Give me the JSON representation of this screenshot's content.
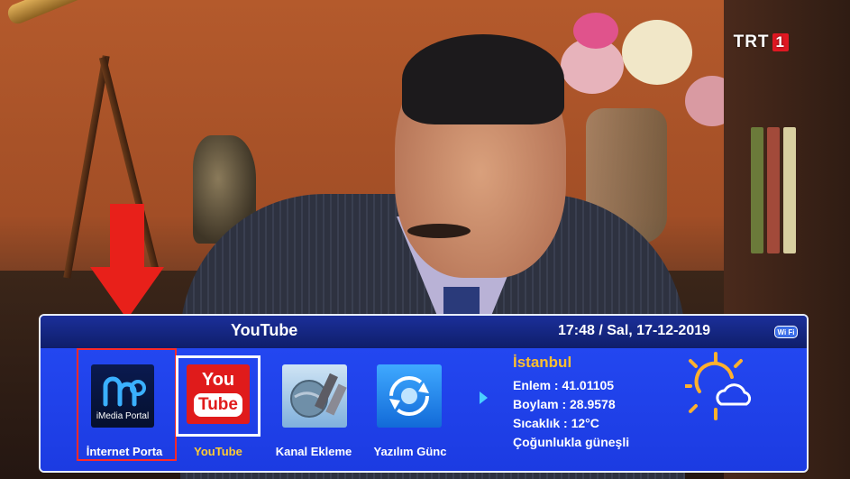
{
  "channel_logo": {
    "name": "TRT",
    "number": "1"
  },
  "panel": {
    "title": "YouTube",
    "clock": "17:48 / Sal, 17-12-2019",
    "wifi_label": "Wi Fi"
  },
  "apps": [
    {
      "label": "İnternet Porta",
      "tile_text": "iMedia Portal",
      "icon": "imedia-portal-icon",
      "selected": false
    },
    {
      "label": "YouTube",
      "tile_text_1": "You",
      "tile_text_2": "Tube",
      "icon": "youtube-icon",
      "selected": true
    },
    {
      "label": "Kanal Ekleme",
      "icon": "satellite-icon",
      "selected": false
    },
    {
      "label": "Yazılım Günc",
      "icon": "software-update-icon",
      "selected": false
    }
  ],
  "weather": {
    "city": "İstanbul",
    "latitude": "Enlem : 41.01105",
    "longitude": "Boylam : 28.9578",
    "temperature": "Sıcaklık : 12°C",
    "condition": "Çoğunlukla güneşli",
    "icon": "partly-sunny-icon"
  },
  "colors": {
    "panel_blue": "#1c3be2",
    "header_blue": "#0f1e6a",
    "selected_label": "#ffcc33",
    "city": "#ffbf2e",
    "highlight_red": "#ff2a2a",
    "arrow_red": "#e8201a"
  }
}
